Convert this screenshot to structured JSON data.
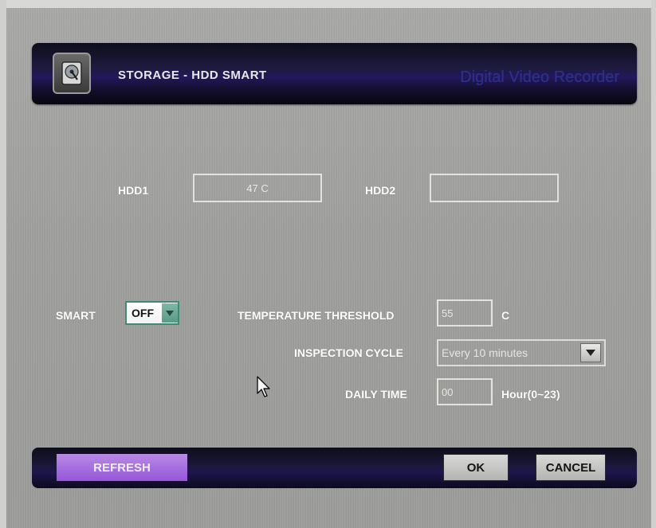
{
  "header": {
    "title": "STORAGE - HDD SMART",
    "brand": "Digital Video Recorder"
  },
  "hdd": {
    "hdd1_label": "HDD1",
    "hdd1_value": "47 C",
    "hdd2_label": "HDD2",
    "hdd2_value": ""
  },
  "smart": {
    "label": "SMART",
    "value": "OFF"
  },
  "temperature_threshold": {
    "label": "TEMPERATURE THRESHOLD",
    "value": "55",
    "unit": "C"
  },
  "inspection_cycle": {
    "label": "INSPECTION CYCLE",
    "value": "Every 10 minutes"
  },
  "daily_time": {
    "label": "DAILY TIME",
    "value": "00",
    "unit": "Hour(0~23)"
  },
  "footer": {
    "refresh_label": "REFRESH",
    "ok_label": "OK",
    "cancel_label": "CANCEL"
  },
  "icons": {
    "header_icon": "hdd-icon",
    "dropdown_arrow": "chevron-down-icon",
    "cursor": "mouse-pointer-icon"
  },
  "colors": {
    "refresh_button": "#9f63dc",
    "header_bar": "#1d1a3e",
    "smart_select_border": "#3e8a74"
  }
}
